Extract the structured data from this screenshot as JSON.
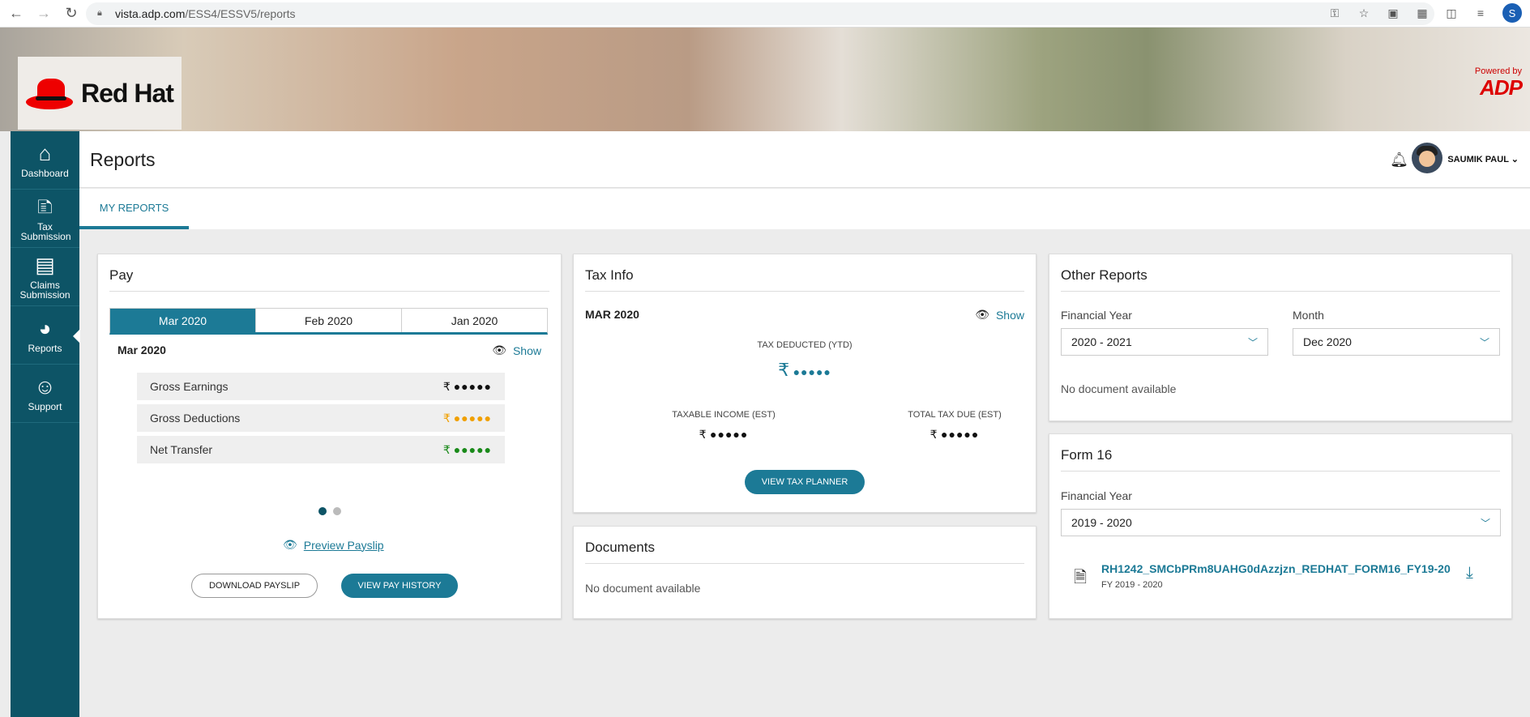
{
  "browser": {
    "url_host": "vista.adp.com",
    "url_path": "/ESS4/ESSV5/reports",
    "profile_initial": "S"
  },
  "brand": {
    "company": "Red Hat",
    "powered_by": "Powered by",
    "adp": "ADP"
  },
  "sidebar": {
    "items": [
      {
        "label": "Dashboard",
        "icon": "home-icon"
      },
      {
        "label": "Tax Submission",
        "icon": "tax-icon"
      },
      {
        "label": "Claims Submission",
        "icon": "claims-icon"
      },
      {
        "label": "Reports",
        "icon": "pie-chart-icon",
        "active": true
      },
      {
        "label": "Support",
        "icon": "support-icon"
      }
    ]
  },
  "header": {
    "title": "Reports",
    "user": "SAUMIK PAUL"
  },
  "tabs": [
    {
      "label": "MY REPORTS"
    }
  ],
  "pay": {
    "title": "Pay",
    "months": [
      "Mar 2020",
      "Feb 2020",
      "Jan 2020"
    ],
    "selected_month": "Mar 2020",
    "show": "Show",
    "rows": [
      {
        "label": "Gross Earnings",
        "symbol": "₹",
        "mask": "●●●●●"
      },
      {
        "label": "Gross Deductions",
        "symbol": "₹",
        "mask": "●●●●●"
      },
      {
        "label": "Net Transfer",
        "symbol": "₹",
        "mask": "●●●●●"
      }
    ],
    "preview": "Preview Payslip",
    "download": "DOWNLOAD PAYSLIP",
    "history": "VIEW PAY HISTORY"
  },
  "tax": {
    "title": "Tax Info",
    "month": "MAR 2020",
    "show": "Show",
    "deducted_label": "TAX DEDUCTED (YTD)",
    "deducted_symbol": "₹",
    "deducted_mask": "●●●●●",
    "taxable_label": "TAXABLE INCOME (EST)",
    "taxable_symbol": "₹",
    "taxable_mask": "●●●●●",
    "due_label": "TOTAL TAX DUE (EST)",
    "due_symbol": "₹",
    "due_mask": "●●●●●",
    "planner": "VIEW TAX PLANNER"
  },
  "documents": {
    "title": "Documents",
    "empty": "No document available"
  },
  "other": {
    "title": "Other Reports",
    "fy_label": "Financial Year",
    "fy_value": "2020 - 2021",
    "month_label": "Month",
    "month_value": "Dec 2020",
    "empty": "No document available"
  },
  "form16": {
    "title": "Form 16",
    "fy_label": "Financial Year",
    "fy_value": "2019 - 2020",
    "file_name": "RH1242_SMCbPRm8UAHG0dAzzjzn_REDHAT_FORM16_FY19-20",
    "file_sub": "FY 2019 - 2020"
  }
}
